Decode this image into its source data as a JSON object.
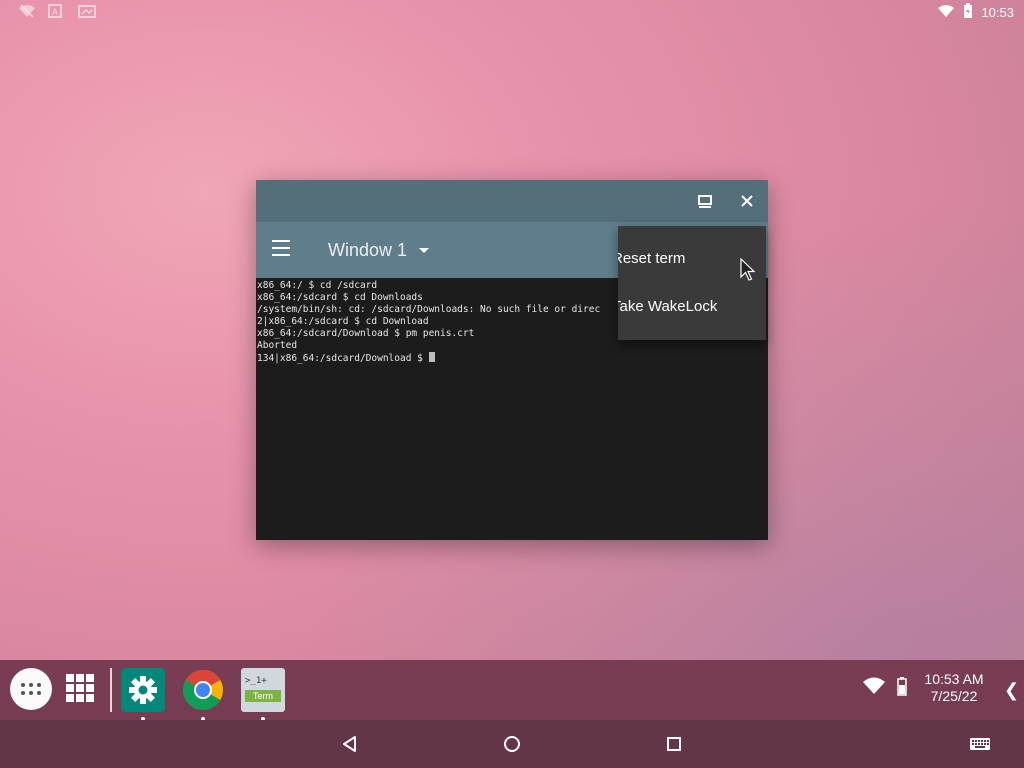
{
  "status_bar": {
    "time": "10:53",
    "icons": [
      "wifi-off-icon",
      "app-a-icon",
      "screenshot-icon",
      "wifi-icon",
      "battery-icon"
    ]
  },
  "terminal_window": {
    "app_bar": {
      "window_title": "Window 1"
    },
    "output_lines": [
      "x86_64:/ $ cd /sdcard",
      "x86_64:/sdcard $ cd Downloads",
      "/system/bin/sh: cd: /sdcard/Downloads: No such file or direc",
      "2|x86_64:/sdcard $ cd Download",
      "x86_64:/sdcard/Download $ pm penis.crt",
      "Aborted",
      "134|x86_64:/sdcard/Download $ "
    ]
  },
  "overflow_menu": {
    "items": [
      {
        "label": "Reset term"
      },
      {
        "label": "Take WakeLock"
      }
    ]
  },
  "taskbar": {
    "apps": [
      {
        "name": "Settings",
        "icon": "gear-icon"
      },
      {
        "name": "Chrome",
        "icon": "chrome-icon"
      },
      {
        "name": "Terminal",
        "icon": "terminal-icon",
        "label_top": ">_1+",
        "label_bottom": "Term"
      }
    ],
    "clock": {
      "time": "10:53 AM",
      "date": "7/25/22"
    },
    "chevron": "❮"
  },
  "colors": {
    "window_titlebar": "#546e7a",
    "app_bar": "#607d8b",
    "terminal_bg": "#1c1c1c",
    "menu_bg": "#3a3a3a",
    "settings_app": "#00897b",
    "taskbar": "#6c3a50"
  }
}
